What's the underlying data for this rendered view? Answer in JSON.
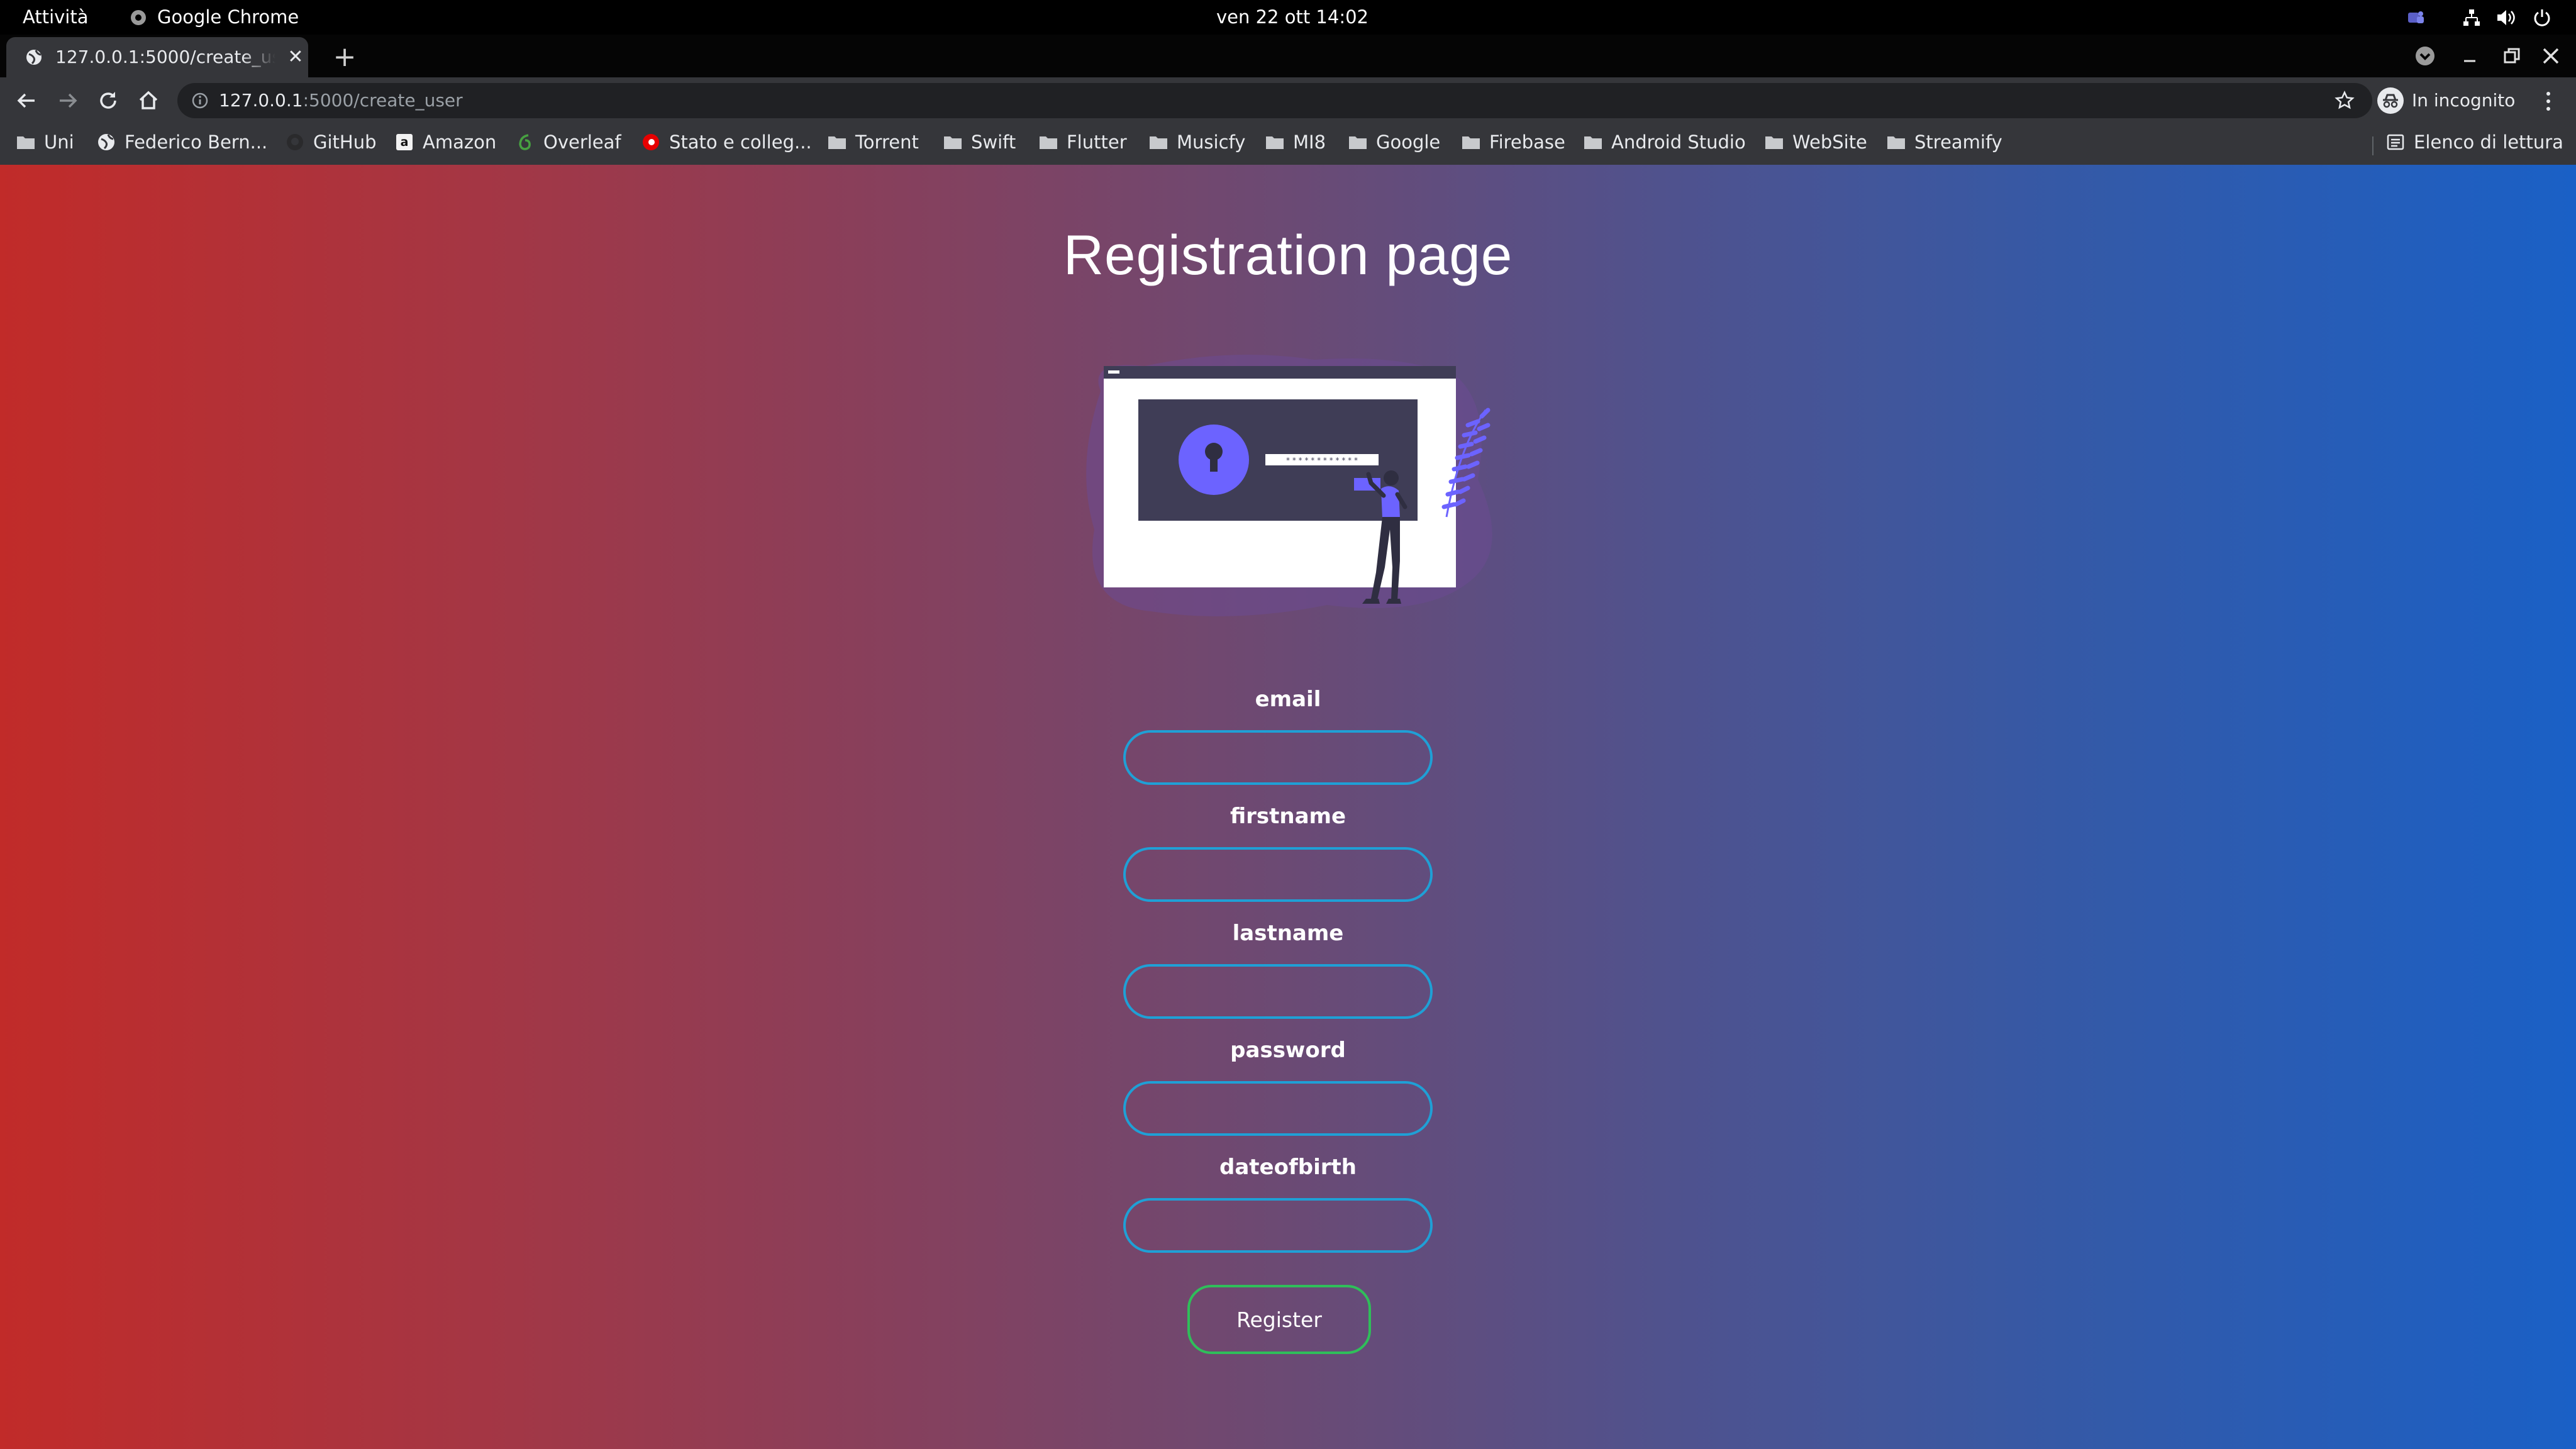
{
  "topbar": {
    "activities": "Attività",
    "app_name": "Google Chrome",
    "clock": "ven 22 ott  14:02"
  },
  "tab": {
    "title": "127.0.0.1:5000/create_user"
  },
  "address_bar": {
    "host": "127.0.0.1",
    "path": ":5000/create_user"
  },
  "incognito_label": "In incognito",
  "bookmarks": [
    {
      "label": "Uni",
      "icon": "folder-icon"
    },
    {
      "label": "Federico Bern...",
      "icon": "globe-icon"
    },
    {
      "label": "GitHub",
      "icon": "github-icon"
    },
    {
      "label": "Amazon",
      "icon": "amazon-icon"
    },
    {
      "label": "Overleaf",
      "icon": "overleaf-icon"
    },
    {
      "label": "Stato e colleg...",
      "icon": "vodafone-icon"
    },
    {
      "label": "Torrent",
      "icon": "folder-icon"
    },
    {
      "label": "Swift",
      "icon": "folder-icon"
    },
    {
      "label": "Flutter",
      "icon": "folder-icon"
    },
    {
      "label": "Musicfy",
      "icon": "folder-icon"
    },
    {
      "label": "MI8",
      "icon": "folder-icon"
    },
    {
      "label": "Google",
      "icon": "folder-icon"
    },
    {
      "label": "Firebase",
      "icon": "folder-icon"
    },
    {
      "label": "Android Studio",
      "icon": "folder-icon"
    },
    {
      "label": "WebSite",
      "icon": "folder-icon"
    },
    {
      "label": "Streamify",
      "icon": "folder-icon"
    }
  ],
  "reading_list": "Elenco di lettura",
  "page": {
    "title": "Registration page",
    "fields": [
      {
        "label": "email",
        "value": ""
      },
      {
        "label": "firstname",
        "value": ""
      },
      {
        "label": "lastname",
        "value": ""
      },
      {
        "label": "password",
        "value": ""
      },
      {
        "label": "dateofbirth",
        "value": ""
      }
    ],
    "register_label": "Register"
  },
  "colors": {
    "gradient_left": "#c12b29",
    "gradient_right": "#1a60c6",
    "field_border": "#1fa0d6",
    "button_border": "#2fbf5a",
    "illustration_accent": "#6c63ff"
  }
}
